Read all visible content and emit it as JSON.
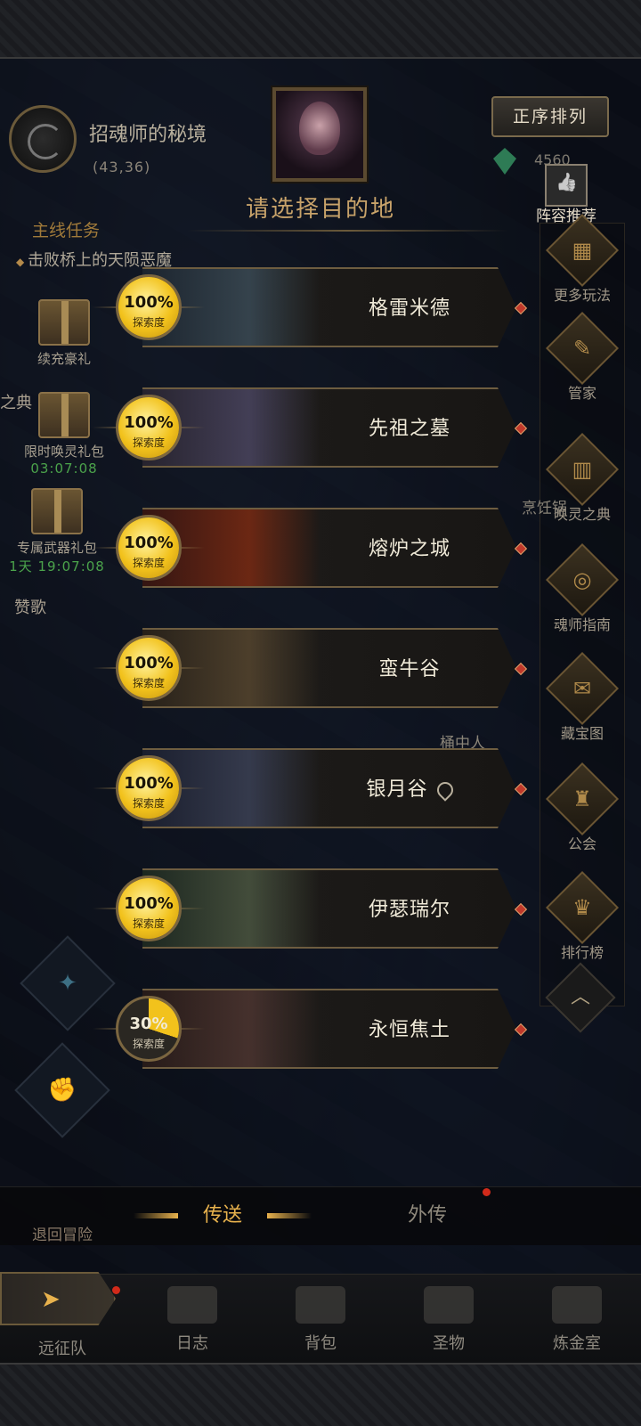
{
  "zone": {
    "name": "招魂师的秘境",
    "coords": "(43,36)"
  },
  "quest": {
    "title": "主线任务",
    "desc": "击败桥上的天陨恶魔"
  },
  "dialog": {
    "title": "请选择目的地"
  },
  "sort_button": "正序排列",
  "resource_count": "4560",
  "recommend_label": "阵容推荐",
  "left_items": [
    {
      "label": "续充豪礼",
      "timer": ""
    },
    {
      "label": "限时唤灵礼包",
      "timer": "03:07:08"
    },
    {
      "label": "专属武器礼包",
      "timer": "1天 19:07:08"
    }
  ],
  "left_cut_text": {
    "a": "之典",
    "b": "赞歌"
  },
  "right_rail": [
    {
      "label": "更多玩法",
      "icon": "grid-icon"
    },
    {
      "label": "管家",
      "icon": "quill-icon"
    },
    {
      "label": "唤灵之典",
      "icon": "book-icon"
    },
    {
      "label": "魂师指南",
      "icon": "compass-icon"
    },
    {
      "label": "藏宝图",
      "icon": "map-icon"
    },
    {
      "label": "公会",
      "icon": "guild-icon"
    },
    {
      "label": "排行榜",
      "icon": "trophy-icon"
    }
  ],
  "background_labels": {
    "cooker": "烹饪锅",
    "barrel": "桶中人"
  },
  "destinations": [
    {
      "name": "格雷米德",
      "progress": "100%",
      "progress_value": 100,
      "progress_label": "探索度",
      "located": false
    },
    {
      "name": "先祖之墓",
      "progress": "100%",
      "progress_value": 100,
      "progress_label": "探索度",
      "located": false
    },
    {
      "name": "熔炉之城",
      "progress": "100%",
      "progress_value": 100,
      "progress_label": "探索度",
      "located": false
    },
    {
      "name": "蛮牛谷",
      "progress": "100%",
      "progress_value": 100,
      "progress_label": "探索度",
      "located": false
    },
    {
      "name": "银月谷",
      "progress": "100%",
      "progress_value": 100,
      "progress_label": "探索度",
      "located": true
    },
    {
      "name": "伊瑟瑞尔",
      "progress": "100%",
      "progress_value": 100,
      "progress_label": "探索度",
      "located": false
    },
    {
      "name": "永恒焦土",
      "progress": "30%",
      "progress_value": 30,
      "progress_label": "探索度",
      "located": false
    }
  ],
  "tabs": {
    "active": "传送",
    "inactive": "外传"
  },
  "retreat_label": "退回冒险",
  "bottom_nav": [
    {
      "label": "远征队"
    },
    {
      "label": "日志"
    },
    {
      "label": "背包"
    },
    {
      "label": "圣物"
    },
    {
      "label": "炼金室"
    }
  ],
  "colors": {
    "accent": "#e8b24d",
    "badge_fill": "#f2c21c",
    "frame": "#6e5d40",
    "notify": "#d12a1a"
  }
}
